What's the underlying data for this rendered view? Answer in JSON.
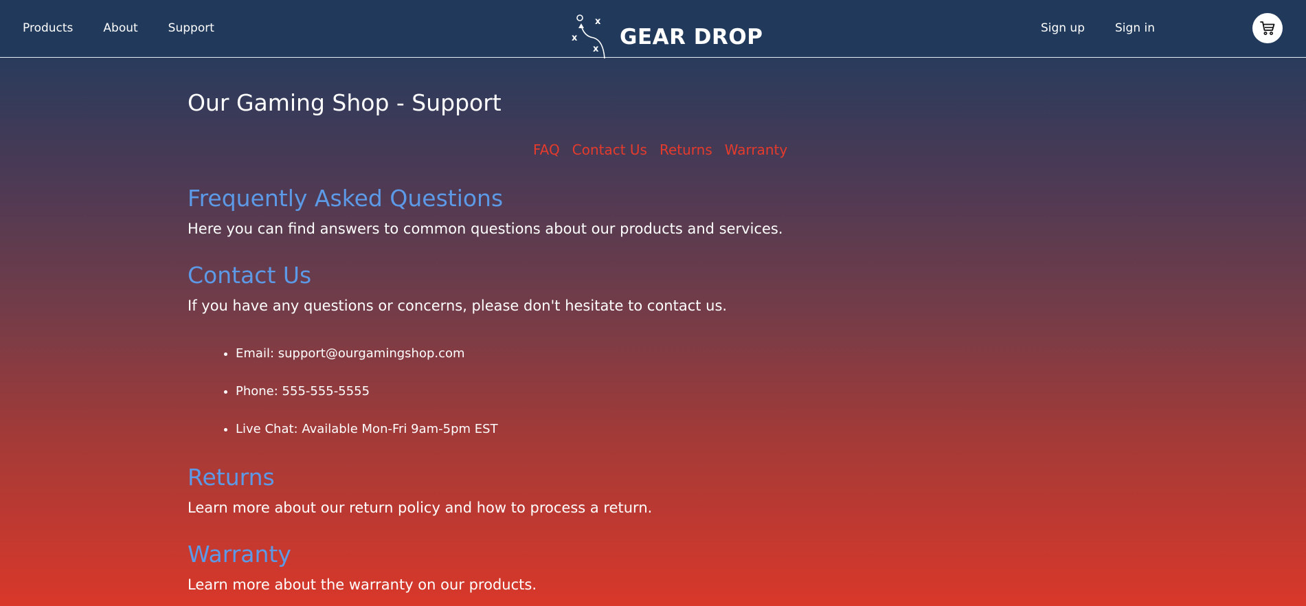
{
  "header": {
    "nav_left": [
      "Products",
      "About",
      "Support"
    ],
    "logo_text": "GEAR DROP",
    "nav_right": [
      "Sign up",
      "Sign in"
    ],
    "cart_icon": "shopping-cart-icon",
    "background_color": "#213a5c"
  },
  "main": {
    "title": "Our Gaming Shop - Support",
    "subnav": [
      "FAQ",
      "Contact Us",
      "Returns",
      "Warranty"
    ],
    "sections": [
      {
        "title": "Frequently Asked Questions",
        "text": "Here you can find answers to common questions about our products and services."
      },
      {
        "title": "Contact Us",
        "text": "If you have any questions or concerns, please don't hesitate to contact us."
      },
      {
        "title": "Returns",
        "text": "Learn more about our return policy and how to process a return."
      },
      {
        "title": "Warranty",
        "text": "Learn more about the warranty on our products."
      }
    ],
    "contact_items": [
      "Email: support@ourgamingshop.com",
      "Phone: 555-555-5555",
      "Live Chat: Available Mon-Fri 9am-5pm EST"
    ]
  },
  "colors": {
    "accent_link": "#e53b2c",
    "section_heading": "#5c9ae8",
    "gradient_top": "#213a5c",
    "gradient_bottom": "#d9382a"
  }
}
